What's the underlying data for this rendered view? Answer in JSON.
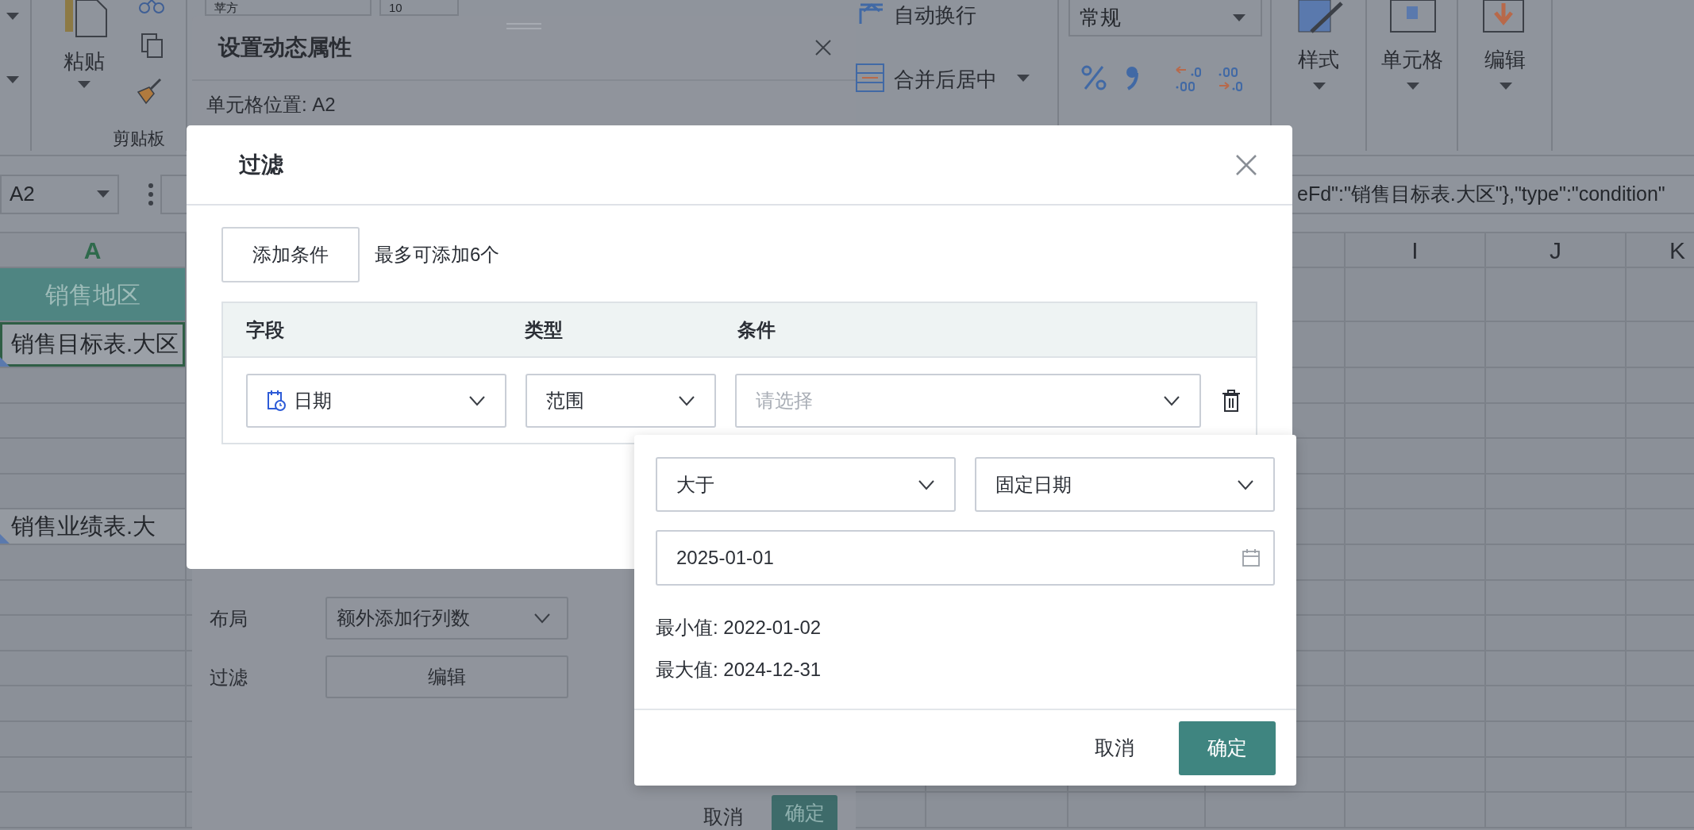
{
  "ribbon": {
    "clipboard": {
      "paste_label": "粘贴",
      "group_label": "剪贴板"
    },
    "font": {
      "font_name": "苹方",
      "font_size": "10"
    },
    "alignment": {
      "wrap_text": "自动换行",
      "merge_center": "合并后居中"
    },
    "number": {
      "format": "常规"
    },
    "buttons": [
      {
        "label": "样式",
        "kind": "style"
      },
      {
        "label": "单元格",
        "kind": "cells"
      },
      {
        "label": "编辑",
        "kind": "edit"
      }
    ]
  },
  "formula_bar": {
    "name_box": "A2",
    "formula": "eFd\":\"销售目标表.大区\"},\"type\":\"condition\""
  },
  "sheet": {
    "column_headers": [
      {
        "label": "A",
        "selected": true
      },
      {
        "label": "I",
        "selected": false
      },
      {
        "label": "J",
        "selected": false
      },
      {
        "label": "K",
        "selected": false
      }
    ],
    "cells": [
      {
        "text": "销售地区",
        "kind": "header",
        "selected": false
      },
      {
        "text": "销售目标表.大区",
        "kind": "field",
        "selected": true
      },
      {
        "text": "销售业绩表.大",
        "kind": "field",
        "selected": false
      }
    ]
  },
  "property_panel": {
    "title": "设置动态属性",
    "cell_position": "单元格位置: A2",
    "fields": [
      {
        "label": "布局",
        "kind": "select",
        "value": "额外添加行列数"
      },
      {
        "label": "过滤",
        "kind": "button",
        "value": "编辑"
      }
    ],
    "buttons": [
      {
        "label": "取消",
        "primary": false
      },
      {
        "label": "确定",
        "primary": true
      }
    ]
  },
  "filter_dialog": {
    "title": "过滤",
    "add_button": "添加条件",
    "hint": "最多可添加6个",
    "columns": [
      "字段",
      "类型",
      "条件"
    ],
    "rows": [
      {
        "field": "日期",
        "type": "范围",
        "condition_placeholder": "请选择"
      }
    ]
  },
  "condition_popover": {
    "operator": "大于",
    "date_mode": "固定日期",
    "date_value": "2025-01-01",
    "min_text": "最小值: 2022-01-02",
    "max_text": "最大值: 2024-12-31",
    "buttons": [
      {
        "label": "取消",
        "primary": false
      },
      {
        "label": "确定",
        "primary": true
      }
    ]
  }
}
